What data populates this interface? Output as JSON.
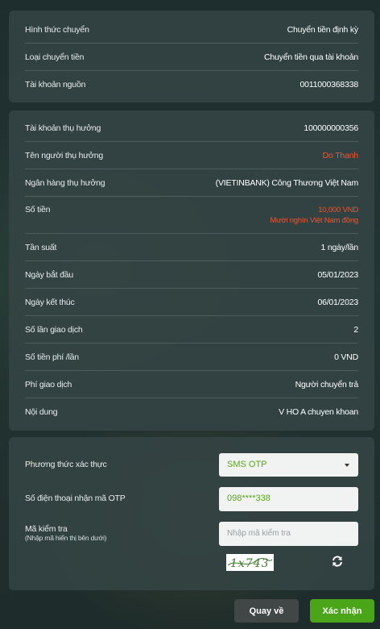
{
  "transfer_info": {
    "rows": [
      {
        "label": "Hình thức chuyển",
        "value": "Chuyển tiền định kỳ"
      },
      {
        "label": "Loại chuyển tiền",
        "value": "Chuyển tiền qua tài khoản"
      },
      {
        "label": "Tài khoản nguồn",
        "value": "0011000368338"
      }
    ]
  },
  "beneficiary": {
    "account_label": "Tài khoản thụ hưởng",
    "account_value": "100000000356",
    "name_label": "Tên người thụ hưởng",
    "name_value": "Do Thanh",
    "bank_label": "Ngân hàng thụ hưởng",
    "bank_value": "(VIETINBANK) Công Thương Việt Nam",
    "amount_label": "Số tiền",
    "amount_value": "10,000 VND",
    "amount_words": "Mười nghìn Việt Nam đồng",
    "frequency_label": "Tần suất",
    "frequency_value": "1 ngày/lần",
    "start_label": "Ngày bắt đầu",
    "start_value": "05/01/2023",
    "end_label": "Ngày kết thúc",
    "end_value": "06/01/2023",
    "count_label": "Số lần giao dịch",
    "count_value": "2",
    "fee_label": "Số tiền phí /lần",
    "fee_value": "0 VND",
    "fee_payer_label": "Phí giao dịch",
    "fee_payer_value": "Người chuyển trả",
    "content_label": "Nội dung",
    "content_value": "V HO A chuyen khoan"
  },
  "auth": {
    "method_label": "Phương thức xác thực",
    "method_value": "SMS OTP",
    "phone_label": "Số điện thoại nhận mã OTP",
    "phone_value": "098****338",
    "captcha_label": "Mã kiểm tra",
    "captcha_hint": "(Nhập mã hiển thị bên dưới)",
    "captcha_placeholder": "Nhập mã kiểm tra",
    "captcha_text": "1x743"
  },
  "actions": {
    "back_label": "Quay về",
    "confirm_label": "Xác nhận"
  },
  "colors": {
    "accent_green": "#4aa618",
    "highlight_red": "#f2542d",
    "card_bg": "#344444"
  },
  "icons": {
    "method_dropdown": "chevron-down-icon",
    "captcha_refresh": "refresh-icon"
  }
}
